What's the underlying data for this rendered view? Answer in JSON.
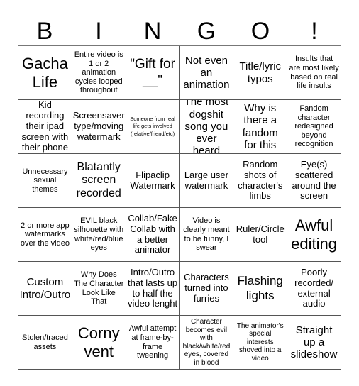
{
  "title": {
    "letters": [
      "B",
      "I",
      "N",
      "G",
      "O",
      "!"
    ]
  },
  "board": {
    "rows": [
      [
        "Gacha Life",
        "Entire video is 1 or 2 animation cycles looped throughout",
        "\"Gift for __\"",
        "Not even an animation",
        "Title/lyric typos",
        "Insults that are most likely based on real life insults"
      ],
      [
        "Kid recording their ipad screen with their phone",
        "Screensaver type/moving watermark",
        "Someone from real life gets involved (relative/friend/etc)",
        "The most dogshit song you ever heard",
        "Why is there a fandom for this",
        "Fandom character redesigned beyond recognition"
      ],
      [
        "Unnecessary sexual themes",
        "Blatantly screen recorded",
        "Flipaclip Watermark",
        "Large user watermark",
        "Random shots of character's limbs",
        "Eye(s) scattered around the screen"
      ],
      [
        "2 or more app watermarks over the video",
        "EVIL black silhouette with white/red/blue eyes",
        "Collab/Fake Collab with a better animator",
        "Video is clearly meant to be funny, I swear",
        "Ruler/Circle tool",
        "Awful editing"
      ],
      [
        "Custom Intro/Outro",
        "Why Does The Character Look Like That",
        "Intro/Outro that lasts up to half the video lenght",
        "Characters turned into furries",
        "Flashing lights",
        "Poorly recorded/ external audio"
      ],
      [
        "Stolen/traced assets",
        "Corny vent",
        "Awful attempt at frame-by-frame tweening",
        "Character becomes evil with black/white/red eyes, covered in blood",
        "The animator's special interests shoved into a video",
        "Straight up a slideshow"
      ]
    ]
  }
}
